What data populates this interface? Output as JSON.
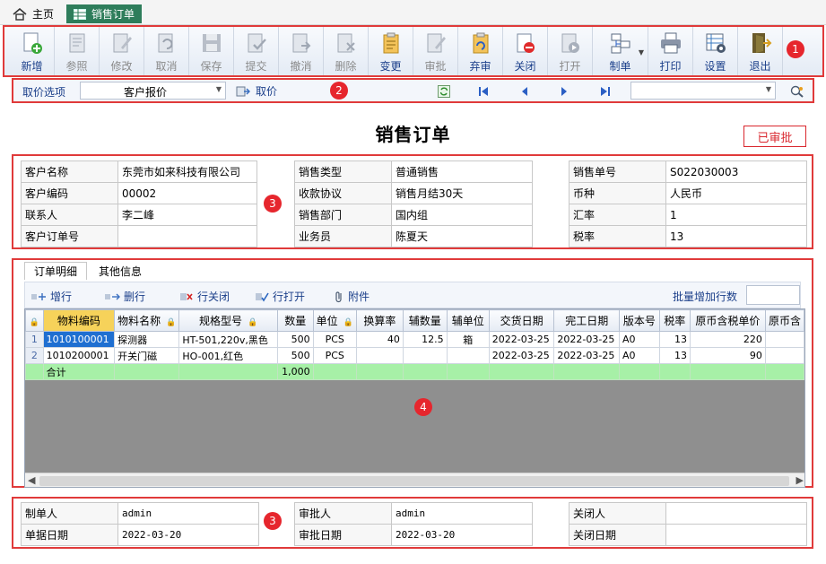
{
  "tabs": {
    "home": "主页",
    "active": "销售订单"
  },
  "toolbar": {
    "buttons": [
      {
        "label": "新增",
        "icon": "new-icon",
        "enabled": true
      },
      {
        "label": "参照",
        "icon": "reference-icon",
        "enabled": false
      },
      {
        "label": "修改",
        "icon": "edit-icon",
        "enabled": false
      },
      {
        "label": "取消",
        "icon": "undo-icon",
        "enabled": false
      },
      {
        "label": "保存",
        "icon": "save-icon",
        "enabled": false
      },
      {
        "label": "提交",
        "icon": "submit-icon",
        "enabled": false
      },
      {
        "label": "撤消",
        "icon": "revoke-icon",
        "enabled": false
      },
      {
        "label": "删除",
        "icon": "delete-icon",
        "enabled": false
      },
      {
        "label": "变更",
        "icon": "change-icon",
        "enabled": true
      },
      {
        "label": "审批",
        "icon": "approve-icon",
        "enabled": false
      },
      {
        "label": "弃审",
        "icon": "unapprove-icon",
        "enabled": true
      },
      {
        "label": "关闭",
        "icon": "close-doc-icon",
        "enabled": true
      },
      {
        "label": "打开",
        "icon": "open-doc-icon",
        "enabled": false
      },
      {
        "label": "制单",
        "icon": "make-doc-icon",
        "enabled": true
      },
      {
        "label": "打印",
        "icon": "printer-icon",
        "enabled": true
      },
      {
        "label": "设置",
        "icon": "settings-icon",
        "enabled": true
      },
      {
        "label": "退出",
        "icon": "exit-icon",
        "enabled": true
      }
    ]
  },
  "badges": [
    "1",
    "2",
    "3",
    "4",
    "3"
  ],
  "options": {
    "label": "取价选项",
    "price_source": "客户报价",
    "fetch_label": "取价",
    "search_value": ""
  },
  "form": {
    "title": "销售订单",
    "status": "已审批",
    "customer": [
      {
        "k": "客户名称",
        "v": "东莞市如来科技有限公司"
      },
      {
        "k": "客户编码",
        "v": "00002"
      },
      {
        "k": "联系人",
        "v": "李二峰"
      },
      {
        "k": "客户订单号",
        "v": ""
      }
    ],
    "sales": [
      {
        "k": "销售类型",
        "v": "普通销售"
      },
      {
        "k": "收款协议",
        "v": "销售月结30天"
      },
      {
        "k": "销售部门",
        "v": "国内组"
      },
      {
        "k": "业务员",
        "v": "陈夏天"
      }
    ],
    "order": [
      {
        "k": "销售单号",
        "v": "S022030003"
      },
      {
        "k": "币种",
        "v": "人民币"
      },
      {
        "k": "汇率",
        "v": "1"
      },
      {
        "k": "税率",
        "v": "13"
      }
    ]
  },
  "detail": {
    "tabs": [
      "订单明细",
      "其他信息"
    ],
    "actions": {
      "add_row": "增行",
      "delete_row": "删行",
      "close_row": "行关闭",
      "open_row": "行打开",
      "attachment": "附件"
    },
    "batch_label": "批量增加行数",
    "batch_value": "",
    "columns": [
      "物料编码",
      "物料名称",
      "规格型号",
      "数量",
      "单位",
      "换算率",
      "辅数量",
      "辅单位",
      "交货日期",
      "完工日期",
      "版本号",
      "税率",
      "原币含税单价",
      "原币含"
    ],
    "rows": [
      {
        "rn": "1",
        "code": "1010100001",
        "name": "探测器",
        "spec": "HT-501,220v,黑色",
        "qty": "500",
        "unit": "PCS",
        "rate": "40",
        "aux_qty": "12.5",
        "aux_unit": "箱",
        "delivery": "2022-03-25",
        "finish": "2022-03-25",
        "version": "A0",
        "tax": "13",
        "price": "220"
      },
      {
        "rn": "2",
        "code": "1010200001",
        "name": "开关门磁",
        "spec": "HO-001,红色",
        "qty": "500",
        "unit": "PCS",
        "rate": "",
        "aux_qty": "",
        "aux_unit": "",
        "delivery": "2022-03-25",
        "finish": "2022-03-25",
        "version": "A0",
        "tax": "13",
        "price": "90"
      }
    ],
    "sum_label": "合计",
    "sum_qty": "1,000"
  },
  "footer": {
    "maker": [
      {
        "k": "制单人",
        "v": "admin"
      },
      {
        "k": "单据日期",
        "v": "2022-03-20"
      }
    ],
    "approver": [
      {
        "k": "审批人",
        "v": "admin"
      },
      {
        "k": "审批日期",
        "v": "2022-03-20"
      }
    ],
    "closer": [
      {
        "k": "关闭人",
        "v": ""
      },
      {
        "k": "关闭日期",
        "v": ""
      }
    ]
  }
}
